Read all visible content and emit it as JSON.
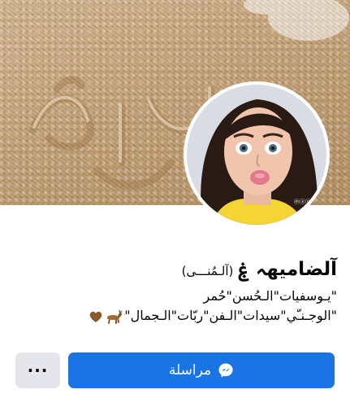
{
  "profile": {
    "name": "آلضاميهہ ۼ",
    "alt_name": "(آلـمُنـــى)",
    "bio_line1": "\"يـوسفيات\"الـحُسن\"حُمر",
    "bio_line2": "\"الوجـنـّي\"سيدات\"الـفن\"ربّات\"الـجمال\"",
    "avatar_caption": "ⓜⓐⓝⓐ"
  },
  "cover": {
    "sand_text": "آلمرـ"
  },
  "actions": {
    "message_label": "مراسلة",
    "more_label": "···"
  },
  "colors": {
    "primary": "#1b74e4",
    "secondary_button": "#e4e6eb",
    "avatar_shirt": "#f5d533"
  },
  "icons": {
    "message": "messenger-icon",
    "deer": "deer-emoji",
    "heart": "brown-heart-emoji"
  }
}
